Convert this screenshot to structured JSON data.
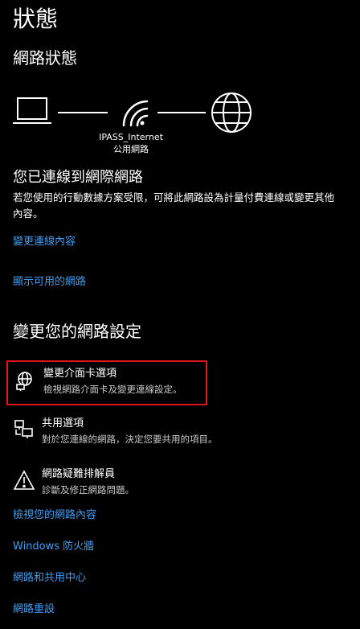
{
  "page": {
    "title": "狀態"
  },
  "network_status": {
    "section_title": "網路狀態",
    "network_name": "IPASS_Internet",
    "network_type": "公用網路",
    "connected_heading": "您已連線到網際網路",
    "description": "若您使用的行動數據方案受限，可將此網路設為計量付費連線或變更其他內容。",
    "links": {
      "change_properties": "變更連線內容",
      "show_available": "顯示可用的網路"
    }
  },
  "change_settings": {
    "section_title": "變更您的網路設定",
    "options": [
      {
        "icon": "adapter-globe-icon",
        "title": "變更介面卡選項",
        "desc": "檢視網路介面卡及變更連線設定。"
      },
      {
        "icon": "sharing-icon",
        "title": "共用選項",
        "desc": "對於您連線的網路，決定您要共用的項目。"
      },
      {
        "icon": "warning-icon",
        "title": "網路疑難排解員",
        "desc": "診斷及修正網路問題。"
      }
    ]
  },
  "bottom_links": {
    "view_properties": "檢視您的網路內容",
    "firewall": "Windows 防火牆",
    "sharing_center": "網路和共用中心",
    "reset": "網路重設"
  },
  "colors": {
    "accent_link": "#3d9df2",
    "highlight_border": "#e4141b"
  }
}
